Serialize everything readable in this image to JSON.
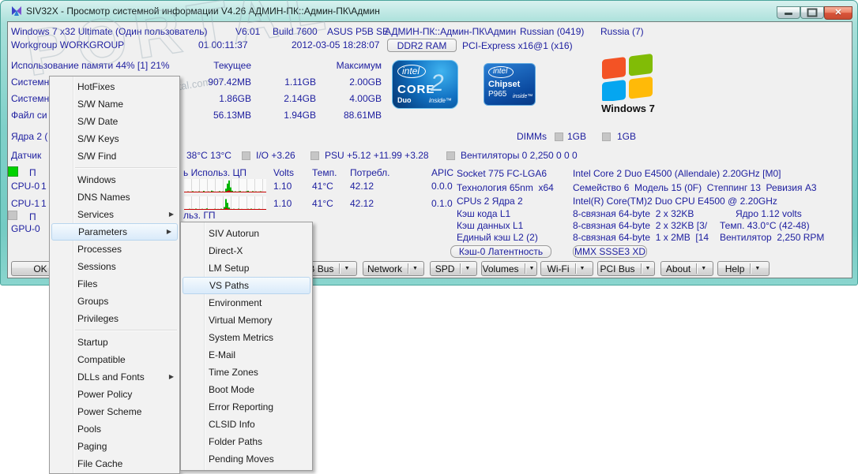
{
  "window": {
    "title": "SIV32X - Просмотр системной информации V4.26 АДМИН-ПК::Админ-ПК\\Админ"
  },
  "header": {
    "os": "Windows 7 x32 Ultimate (Один пользователь)",
    "version": "V6.01",
    "build": "Build 7600",
    "motherboard": "ASUS P5B SE",
    "machine": "АДМИН-ПК::Админ-ПК\\Админ",
    "language": "Russian (0419)",
    "country": "Russia (7)",
    "workgroup": "Workgroup WORKGROUP",
    "uptime": "01 00:11:37",
    "datetime": "2012-03-05 18:28:07",
    "ram_button": "DDR2 RAM",
    "pcie": "PCI-Express x16@1 (x16)"
  },
  "memory": {
    "title": "Использование памяти 44% [1] 21%",
    "col_current": "Текущее",
    "col_max": "Максимум",
    "rows": [
      {
        "label": "Системн",
        "current": "907.42MB",
        "peak": "1.11GB",
        "max": "2.00GB"
      },
      {
        "label": "Системн",
        "current": "1.86GB",
        "peak": "2.14GB",
        "max": "4.00GB"
      },
      {
        "label": "Файл си",
        "current": "56.13MB",
        "peak": "1.94GB",
        "max": "88.61MB"
      }
    ]
  },
  "cores": {
    "label": "Ядра 2 (",
    "dimms_label": "DIMMs",
    "dimm1": "1GB",
    "dimm2": "1GB"
  },
  "sensors": {
    "label": "Датчик",
    "temps": "38°C 13°C",
    "io": "I/O +3.26",
    "psu": "PSU +5.12 +11.99 +3.28",
    "fans": "Вентиляторы 0 2,250 0 0 0"
  },
  "cpu": {
    "header_fragment": "П",
    "gpu_header_fragment": "П",
    "usage_header": "ь Использ. ЦП",
    "col_volts": "Volts",
    "col_temp": "Темп.",
    "col_power": "Потребл.",
    "col_apic": "APIC",
    "rows": [
      {
        "name": "CPU-0",
        "speed_fragment": "1",
        "volts": "1.10",
        "temp": "41°C",
        "power": "42.12",
        "apic": "0.0.0",
        "graph_user": [
          6,
          4,
          8,
          3,
          5,
          10,
          4,
          7,
          3,
          9,
          5,
          4,
          12,
          6,
          3,
          8,
          4,
          14,
          9,
          5,
          3,
          7,
          10,
          4,
          8,
          5,
          30,
          70,
          95,
          40,
          14,
          7,
          9,
          4,
          8,
          11,
          5,
          7,
          4,
          9,
          13,
          6,
          4,
          10,
          5,
          8,
          4,
          7,
          9,
          5,
          6,
          4
        ],
        "graph_kernel": [
          2,
          1,
          3,
          1,
          2,
          3,
          1,
          2,
          1,
          3,
          2,
          1,
          4,
          2,
          1,
          3,
          1,
          4,
          3,
          2,
          1,
          2,
          3,
          1,
          2,
          2,
          8,
          15,
          20,
          10,
          4,
          2,
          3,
          1,
          2,
          3,
          2,
          2,
          1,
          3,
          4,
          2,
          1,
          3,
          2,
          2,
          1,
          2,
          3,
          1,
          2,
          1
        ]
      },
      {
        "name": "CPU-1",
        "speed_fragment": "1",
        "volts": "1.10",
        "temp": "41°C",
        "power": "42.12",
        "apic": "0.1.0",
        "graph_user": [
          4,
          6,
          3,
          8,
          5,
          7,
          4,
          9,
          3,
          6,
          5,
          8,
          4,
          7,
          11,
          5,
          3,
          6,
          4,
          8,
          5,
          7,
          3,
          9,
          6,
          22,
          85,
          55,
          18,
          7,
          5,
          8,
          4,
          6,
          9,
          5,
          7,
          4,
          6,
          3,
          8,
          5,
          9,
          4,
          7,
          5,
          6,
          8,
          4,
          6,
          3,
          5
        ],
        "graph_kernel": [
          1,
          2,
          1,
          3,
          2,
          2,
          1,
          3,
          1,
          2,
          2,
          3,
          1,
          2,
          4,
          2,
          1,
          2,
          1,
          3,
          2,
          2,
          1,
          3,
          2,
          6,
          18,
          12,
          5,
          2,
          1,
          3,
          1,
          2,
          3,
          2,
          2,
          1,
          2,
          1,
          3,
          2,
          3,
          1,
          2,
          2,
          2,
          3,
          1,
          2,
          1,
          2
        ]
      }
    ],
    "gpu_usage_header": "льз. ГП",
    "gpu_name": "GPU-0"
  },
  "cpu_info": {
    "rows": [
      {
        "label": "Socket 775 FC-LGA6",
        "value": "Intel Core 2 Duo E4500 (Allendale) 2.20GHz [M0]"
      },
      {
        "label": "Технология 65nm  x64",
        "value": "Семейство 6  Модель 15 (0F)  Степпинг 13  Ревизия A3"
      },
      {
        "label": "CPUs 2 Ядра 2",
        "value": "Intel(R) Core(TM)2 Duo CPU E4500 @ 2.20GHz"
      },
      {
        "label": "Кэш кода L1",
        "value": "8-связная 64-byte  2 x 32KB",
        "extra": "Ядро 1.12 volts"
      },
      {
        "label": "Кэш данных L1",
        "value": "8-связная 64-byte  2 x 32KB [3/",
        "extra": "Темп. 43.0°C (42-48)"
      },
      {
        "label": "Единый кэш L2 (2)",
        "value": "8-связная 64-byte  1 x 2MB  [14",
        "extra": "Вентилятор  2,250 RPM"
      }
    ],
    "btn_cache": "Кэш-0 Латентность",
    "btn_mmx": "MMX SSSE3 XD"
  },
  "toolbar": {
    "ok": "OK",
    "items": [
      "USB Bus",
      "Network",
      "SPD",
      "Volumes",
      "Wi-Fi",
      "PCI Bus",
      "About",
      "Help"
    ]
  },
  "menu": {
    "items": [
      {
        "label": "HotFixes"
      },
      {
        "label": "S/W Name"
      },
      {
        "label": "S/W Date"
      },
      {
        "label": "S/W Keys"
      },
      {
        "label": "S/W Find",
        "sep_after": true
      },
      {
        "label": "Windows"
      },
      {
        "label": "DNS Names"
      },
      {
        "label": "Services",
        "submenu": true
      },
      {
        "label": "Parameters",
        "submenu": true,
        "highlight": true
      },
      {
        "label": "Processes"
      },
      {
        "label": "Sessions"
      },
      {
        "label": "Files"
      },
      {
        "label": "Groups"
      },
      {
        "label": "Privileges",
        "sep_after": true
      },
      {
        "label": "Startup"
      },
      {
        "label": "Compatible"
      },
      {
        "label": "DLLs and Fonts",
        "submenu": true
      },
      {
        "label": "Power Policy"
      },
      {
        "label": "Power Scheme"
      },
      {
        "label": "Pools"
      },
      {
        "label": "Paging"
      },
      {
        "label": "File Cache"
      }
    ]
  },
  "submenu": {
    "items": [
      "SIV Autorun",
      "Direct-X",
      "LM Setup",
      "VS Paths",
      "Environment",
      "Virtual Memory",
      "System Metrics",
      "E-Mail",
      "Time Zones",
      "Boot Mode",
      "Error Reporting",
      "CLSID Info",
      "Folder Paths",
      "Pending Moves"
    ],
    "highlighted": "VS Paths"
  },
  "logos": {
    "core2": {
      "brand": "intel",
      "name": "CORE",
      "num": "2",
      "sub": "Duo",
      "inside": "inside™"
    },
    "chipset": {
      "brand": "intel",
      "name": "Chipset",
      "model": "P965",
      "inside": "inside™"
    },
    "windows_caption": "Windows 7"
  },
  "watermark": {
    "big": "PORTAL",
    "small": "— www.softportal.com —"
  },
  "colors": {
    "accent_navy": "#1f20a0",
    "frame_teal": "#7fd0c9",
    "menu_highlight": "#d9eafa",
    "graph_green": "#00b400",
    "graph_red": "#c80000",
    "indicator_green": "#00d200",
    "indicator_gray": "#c6c6c6",
    "close_red": "#d9543a"
  }
}
